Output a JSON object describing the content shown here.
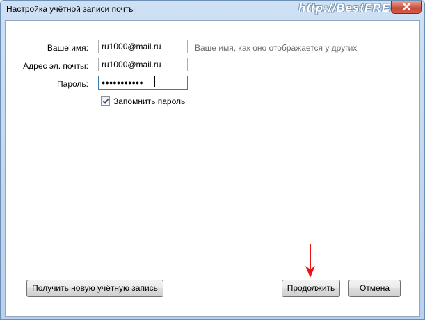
{
  "window": {
    "title": "Настройка учётной записи почты",
    "watermark": "http://BestFREE.ru"
  },
  "form": {
    "name_label": "Ваше имя:",
    "name_value": "ru1000@mail.ru",
    "name_hint": "Ваше имя, как оно отображается у других",
    "email_label": "Адрес эл. почты:",
    "email_value": "ru1000@mail.ru",
    "password_label": "Пароль:",
    "password_value": "●●●●●●●●●●●",
    "remember_label": "Запомнить пароль",
    "remember_checked": true
  },
  "buttons": {
    "new_account": "Получить новую учётную запись",
    "continue": "Продолжить",
    "cancel": "Отмена"
  },
  "colors": {
    "annotation_arrow": "#e8121b"
  },
  "icons": [
    "close-icon",
    "check-icon",
    "red-arrow-annotation"
  ]
}
